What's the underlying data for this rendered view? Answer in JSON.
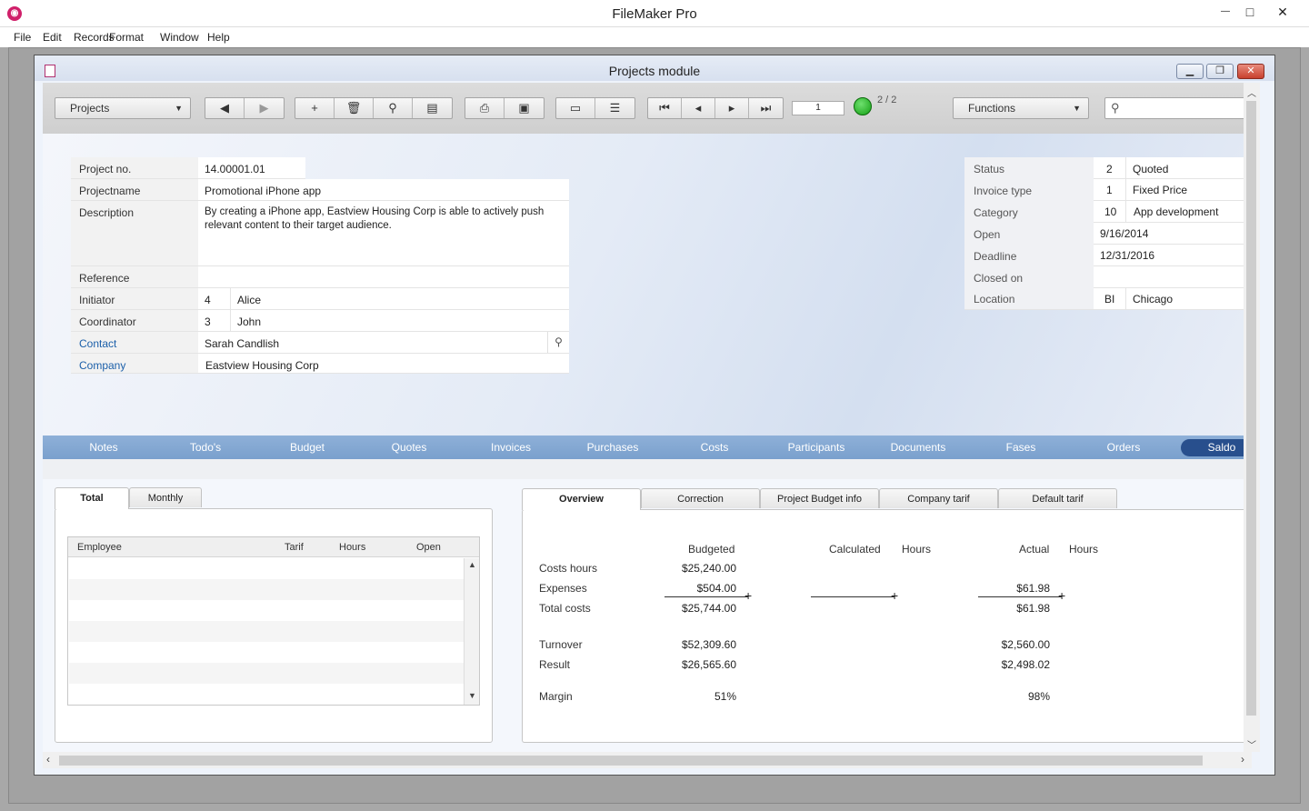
{
  "app": {
    "title": "FileMaker Pro"
  },
  "window_controls": {
    "minimize": "—",
    "maximize": "□",
    "close": "✕"
  },
  "menu": [
    "File",
    "Edit",
    "Records",
    "Format",
    "Window",
    "Help"
  ],
  "child_window": {
    "title": "Projects module"
  },
  "toolbar": {
    "layout_select": "Projects",
    "record_number": "1",
    "record_count": "2 / 2",
    "functions_label": "Functions",
    "search_placeholder": ""
  },
  "project": {
    "left_fields": [
      {
        "label": "Project no.",
        "value": "14.00001.01"
      },
      {
        "label": "Projectname",
        "value": "Promotional iPhone app"
      },
      {
        "label": "Description",
        "value": "By creating a iPhone app, Eastview Housing Corp is able to actively push relevant content to their target audience."
      },
      {
        "label": "Reference",
        "value": ""
      },
      {
        "label": "Initiator",
        "code": "4",
        "value": "Alice"
      },
      {
        "label": "Coordinator",
        "code": "3",
        "value": "John"
      },
      {
        "label": "Contact",
        "value": "Sarah Candlish"
      },
      {
        "label": "Company",
        "value": "Eastview Housing Corp"
      }
    ],
    "right_fields": [
      {
        "label": "Status",
        "code": "2",
        "value": "Quoted"
      },
      {
        "label": "Invoice type",
        "code": "1",
        "value": "Fixed Price"
      },
      {
        "label": "Category",
        "code": "10",
        "value": "App development"
      },
      {
        "label": "Open",
        "value": "9/16/2014"
      },
      {
        "label": "Deadline",
        "value": "12/31/2016"
      },
      {
        "label": "Closed on",
        "value": ""
      },
      {
        "label": "Location",
        "code": "BI",
        "value": "Chicago"
      }
    ]
  },
  "tabs": [
    "Notes",
    "Todo's",
    "Budget",
    "Quotes",
    "Invoices",
    "Purchases",
    "Costs",
    "Participants",
    "Documents",
    "Fases",
    "Orders",
    "Saldo"
  ],
  "left_panel": {
    "tabs": [
      "Total",
      "Monthly"
    ],
    "columns": [
      "Employee",
      "Tarif",
      "Hours",
      "Open"
    ]
  },
  "right_panel": {
    "tabs": [
      "Overview",
      "Correction",
      "Project Budget info",
      "Company tarif",
      "Default tarif"
    ],
    "headers": {
      "budgeted": "Budgeted",
      "calculated": "Calculated",
      "hours1": "Hours",
      "actual": "Actual",
      "hours2": "Hours"
    },
    "rows": [
      {
        "label": "Costs hours",
        "budgeted": "$25,240.00",
        "actual": ""
      },
      {
        "label": "Expenses",
        "budgeted": "$504.00",
        "actual": "$61.98"
      },
      {
        "label": "Total costs",
        "budgeted": "$25,744.00",
        "actual": "$61.98"
      },
      {
        "label": "Turnover",
        "budgeted": "$52,309.60",
        "actual": "$2,560.00"
      },
      {
        "label": "Result",
        "budgeted": "$26,565.60",
        "actual": "$2,498.02"
      },
      {
        "label": "Margin",
        "budgeted": "51%",
        "actual": "98%"
      }
    ]
  }
}
